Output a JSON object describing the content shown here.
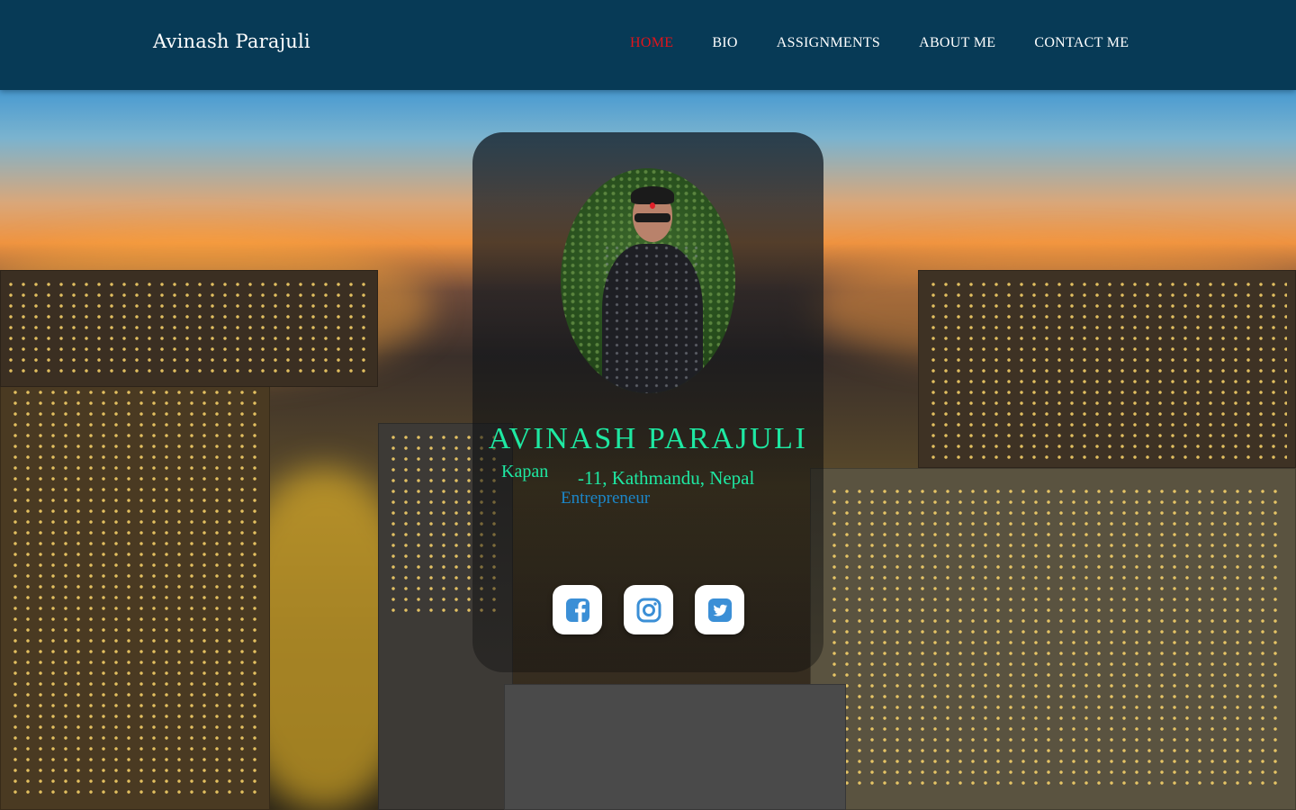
{
  "header": {
    "brand": "Avinash Parajuli",
    "nav": [
      {
        "label": "HOME",
        "active": true
      },
      {
        "label": "BIO"
      },
      {
        "label": "ASSIGNMENTS"
      },
      {
        "label": "ABOUT ME"
      },
      {
        "label": "CONTACT ME"
      }
    ]
  },
  "profile": {
    "name": "AVINASH  PARAJULI",
    "address_part1": "Kapan",
    "address_part2": "-11, Kathmandu, Nepal",
    "role": "Entrepreneur"
  },
  "social": [
    {
      "icon": "facebook-icon"
    },
    {
      "icon": "instagram-icon"
    },
    {
      "icon": "twitter-icon"
    }
  ],
  "colors": {
    "header_bg": "#073a56",
    "nav_active": "#e2141b",
    "name_text": "#1ee8a2",
    "role_text": "#1c87c9",
    "icon_blue": "#3b8fd6"
  }
}
